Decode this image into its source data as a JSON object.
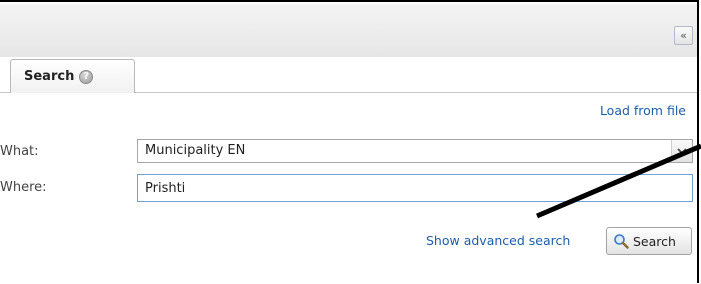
{
  "header": {
    "collapse_glyph": "«"
  },
  "tabs": [
    {
      "label": "Search",
      "help_glyph": "?"
    }
  ],
  "form": {
    "load_from_file": "Load from file",
    "what_label": "What:",
    "what_value": "Municipality EN",
    "where_label": "Where:",
    "where_value": "Prishti",
    "advanced_link": "Show advanced search",
    "search_button": "Search"
  },
  "icons": {
    "collapse": "double-chevron-left-icon",
    "help": "help-icon",
    "dropdown": "chevron-down-icon",
    "search": "magnifier-icon"
  },
  "colors": {
    "link": "#1d5da8",
    "focus_border": "#6fa3d6"
  }
}
